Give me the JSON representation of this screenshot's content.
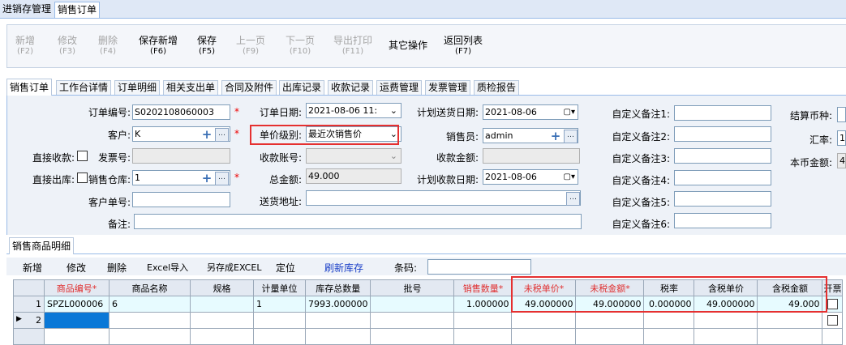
{
  "top_tabs": [
    "进销存管理",
    "销售订单"
  ],
  "toolbar": [
    {
      "label": "新增",
      "key": "(F2)",
      "enabled": false
    },
    {
      "label": "修改",
      "key": "(F3)",
      "enabled": false
    },
    {
      "label": "删除",
      "key": "(F4)",
      "enabled": false
    },
    {
      "label": "保存新增",
      "key": "(F6)",
      "enabled": true
    },
    {
      "label": "保存",
      "key": "(F5)",
      "enabled": true
    },
    {
      "label": "上一页",
      "key": "(F9)",
      "enabled": false
    },
    {
      "label": "下一页",
      "key": "(F10)",
      "enabled": false
    },
    {
      "label": "导出打印",
      "key": "(F11)",
      "enabled": false
    },
    {
      "label": "其它操作",
      "key": "",
      "enabled": true
    },
    {
      "label": "返回列表",
      "key": "(F7)",
      "enabled": true
    }
  ],
  "sub_tabs": [
    "销售订单",
    "工作台详情",
    "订单明细",
    "相关支出单",
    "合同及附件",
    "出库记录",
    "收款记录",
    "运费管理",
    "发票管理",
    "质检报告"
  ],
  "form": {
    "order_no_label": "订单编号:",
    "order_no": "S0202108060003",
    "order_date_label": "订单日期:",
    "order_date": "2021-08-06 11:",
    "plan_ship_label": "计划送货日期:",
    "plan_ship": "2021-08-06",
    "customer_label": "客户:",
    "customer": "K",
    "price_level_label": "单价级别:",
    "price_level": "最近次销售价",
    "salesman_label": "销售员:",
    "salesman": "admin",
    "direct_receive_label": "直接收款:",
    "invoice_no_label": "发票号:",
    "account_label": "收款账号:",
    "receive_amount_label": "收款金额:",
    "direct_out_label": "直接出库:",
    "warehouse_label": "销售仓库:",
    "warehouse": "1",
    "total_label": "总金额:",
    "total": "49.000",
    "plan_receive_label": "计划收款日期:",
    "plan_receive": "2021-08-06",
    "customer_order_label": "客户单号:",
    "address_label": "送货地址:",
    "remark_label": "备注:",
    "custom_labels": [
      "自定义备注1:",
      "自定义备注2:",
      "自定义备注3:",
      "自定义备注4:",
      "自定义备注5:",
      "自定义备注6:"
    ],
    "currency_label": "结算币种:",
    "rate_label": "汇率:",
    "rate": "1.",
    "local_amount_label": "本币金额:",
    "local_amount": "49"
  },
  "detail_section": "销售商品明细",
  "grid_toolbar": {
    "add": "新增",
    "edit": "修改",
    "delete": "删除",
    "excel_import": "Excel导入",
    "save_excel": "另存成EXCEL",
    "locate": "定位",
    "refresh_stock": "刷新库存",
    "barcode_label": "条码:"
  },
  "grid": {
    "headers": [
      "商品编号*",
      "商品名称",
      "规格",
      "计量单位",
      "库存总数量",
      "批号",
      "销售数量*",
      "未税单价*",
      "未税金额*",
      "税率",
      "含税单价",
      "含税金额",
      "开票"
    ],
    "rows": [
      {
        "no": "1",
        "code": "SPZL000006",
        "name": "6",
        "spec": "",
        "unit": "1",
        "stock": "7993.000000",
        "batch": "",
        "qty": "1.000000",
        "price": "49.000000",
        "amount": "49.000000",
        "tax": "0.000000",
        "tax_price": "49.000000",
        "tax_amount": "49.000"
      },
      {
        "no": "2",
        "code": "",
        "name": "",
        "spec": "",
        "unit": "",
        "stock": "",
        "batch": "",
        "qty": "",
        "price": "",
        "amount": "",
        "tax": "",
        "tax_price": "",
        "tax_amount": ""
      }
    ]
  }
}
